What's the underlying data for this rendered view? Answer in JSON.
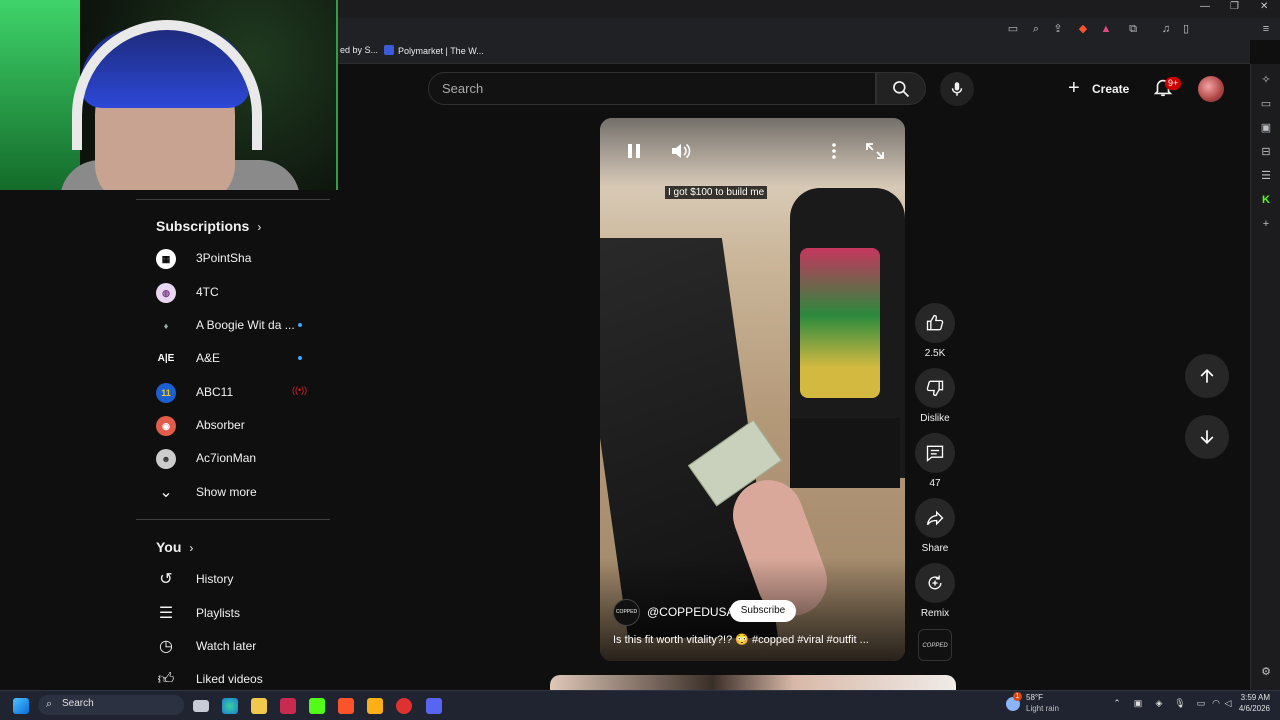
{
  "browser": {
    "bookmarks": [
      {
        "label": "ed by S..."
      },
      {
        "label": "Polymarket | The W..."
      }
    ]
  },
  "topbar": {
    "search_placeholder": "Search",
    "create_label": "Create",
    "notification_count": "9+"
  },
  "sidebar": {
    "subscriptions_heading": "Subscriptions",
    "subscriptions": [
      {
        "label": "3PointSha",
        "icon": "channel-avatar",
        "indicator": "none",
        "color": "#ffffff"
      },
      {
        "label": "4TC",
        "icon": "channel-avatar",
        "indicator": "none",
        "color": "#e9d6f0"
      },
      {
        "label": "A Boogie Wit da ...",
        "icon": "channel-avatar",
        "indicator": "new",
        "color": "#5a7a6a"
      },
      {
        "label": "A&E",
        "icon": "channel-avatar",
        "indicator": "new",
        "color": "#0f0f0f"
      },
      {
        "label": "ABC11",
        "icon": "channel-avatar",
        "indicator": "live",
        "color": "#1c5fd0"
      },
      {
        "label": "Absorber",
        "icon": "channel-avatar",
        "indicator": "none",
        "color": "#e25c4b"
      },
      {
        "label": "Ac7ionMan",
        "icon": "channel-avatar",
        "indicator": "none",
        "color": "#cccccc"
      }
    ],
    "show_more_label": "Show more",
    "you_heading": "You",
    "you_items": [
      {
        "label": "History",
        "icon": "history-icon"
      },
      {
        "label": "Playlists",
        "icon": "playlists-icon"
      },
      {
        "label": "Watch later",
        "icon": "clock-icon"
      },
      {
        "label": "Liked videos",
        "icon": "thumbs-up-icon"
      }
    ]
  },
  "short": {
    "caption_overlay": "I got $100 to build me",
    "channel_logo_text": "COPPED",
    "channel_handle": "@COPPEDUSA",
    "subscribe_label": "Subscribe",
    "title": "Is this fit worth vitality?!? 😳 #copped #viral #outfit ...",
    "actions": {
      "like_count": "2.5K",
      "dislike_label": "Dislike",
      "comment_count": "47",
      "share_label": "Share",
      "remix_label": "Remix"
    },
    "sound_thumb_text": "COPPED"
  },
  "taskbar": {
    "search_label": "Search",
    "weather_temp": "58°F",
    "weather_desc": "Light rain",
    "time": "3:59 AM",
    "date": "4/6/2026",
    "weather_badge": "1"
  },
  "colors": {
    "accent_red": "#cc0000",
    "background": "#0f0f0f",
    "new_dot": "#3ea6ff"
  }
}
